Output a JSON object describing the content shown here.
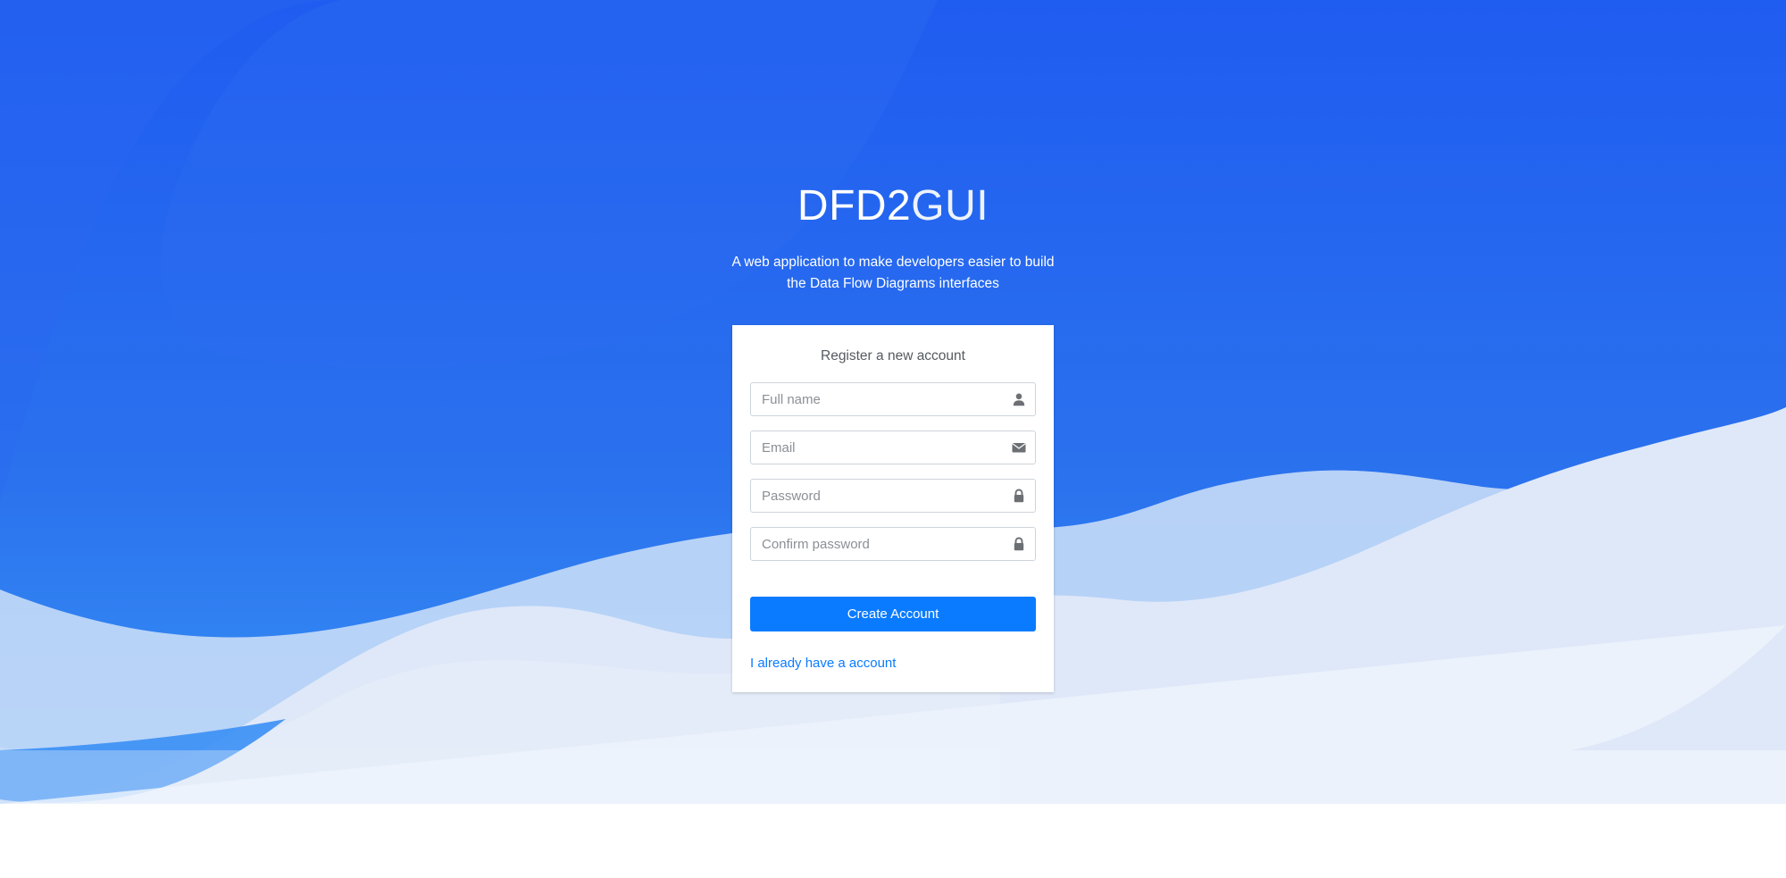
{
  "brand": {
    "name_bold": "DFD2",
    "name_light": "GUI"
  },
  "tagline": {
    "line1": "A web application to make developers easier to build",
    "line2": "the Data Flow Diagrams interfaces"
  },
  "register": {
    "title": "Register a new account",
    "fields": [
      {
        "placeholder": "Full name",
        "value": "",
        "icon": "user-icon"
      },
      {
        "placeholder": "Email",
        "value": "",
        "icon": "envelope-icon"
      },
      {
        "placeholder": "Password",
        "value": "",
        "icon": "lock-icon"
      },
      {
        "placeholder": "Confirm password",
        "value": "",
        "icon": "lock-icon"
      }
    ],
    "submit_label": "Create Account",
    "login_link": "I already have a account"
  },
  "colors": {
    "background_top": "#1f5ef0",
    "background_bottom": "#3a8ff5",
    "wave_light": "#dfe8f8",
    "accent": "#0a7bff"
  }
}
